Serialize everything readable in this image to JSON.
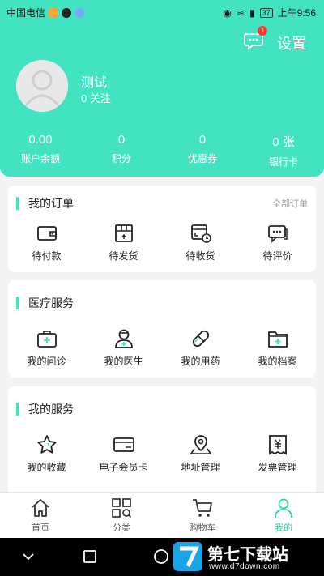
{
  "status_bar": {
    "carrier": "中国电信",
    "battery": "37",
    "time": "上午9:56"
  },
  "header": {
    "settings_label": "设置",
    "message_badge": "1",
    "username": "测试",
    "follow": "0 关注",
    "stats": [
      {
        "value": "0.00",
        "label": "账户余额"
      },
      {
        "value": "0",
        "label": "积分"
      },
      {
        "value": "0",
        "label": "优惠券"
      },
      {
        "value": "0 张",
        "label": "银行卡"
      }
    ]
  },
  "orders": {
    "title": "我的订单",
    "more": "全部订单",
    "items": [
      {
        "label": "待付款",
        "icon": "wallet-icon"
      },
      {
        "label": "待发货",
        "icon": "package-icon"
      },
      {
        "label": "待收货",
        "icon": "delivery-icon"
      },
      {
        "label": "待评价",
        "icon": "comment-icon"
      }
    ]
  },
  "medical": {
    "title": "医疗服务",
    "items": [
      {
        "label": "我的问诊",
        "icon": "medical-kit-icon"
      },
      {
        "label": "我的医生",
        "icon": "doctor-icon"
      },
      {
        "label": "我的用药",
        "icon": "pill-icon"
      },
      {
        "label": "我的档案",
        "icon": "folder-plus-icon"
      }
    ]
  },
  "services": {
    "title": "我的服务",
    "items": [
      {
        "label": "我的收藏",
        "icon": "star-icon"
      },
      {
        "label": "电子会员卡",
        "icon": "vip-card-icon"
      },
      {
        "label": "地址管理",
        "icon": "map-pin-icon"
      },
      {
        "label": "发票管理",
        "icon": "invoice-icon"
      }
    ]
  },
  "tabs": [
    {
      "label": "首页",
      "icon": "home-icon"
    },
    {
      "label": "分类",
      "icon": "category-icon"
    },
    {
      "label": "购物车",
      "icon": "cart-icon"
    },
    {
      "label": "我的",
      "icon": "user-icon"
    }
  ],
  "watermark": {
    "name": "第七下载站",
    "url": "www.d7down.com"
  },
  "colors": {
    "accent": "#42e3c1",
    "badge": "#ff3b30"
  }
}
